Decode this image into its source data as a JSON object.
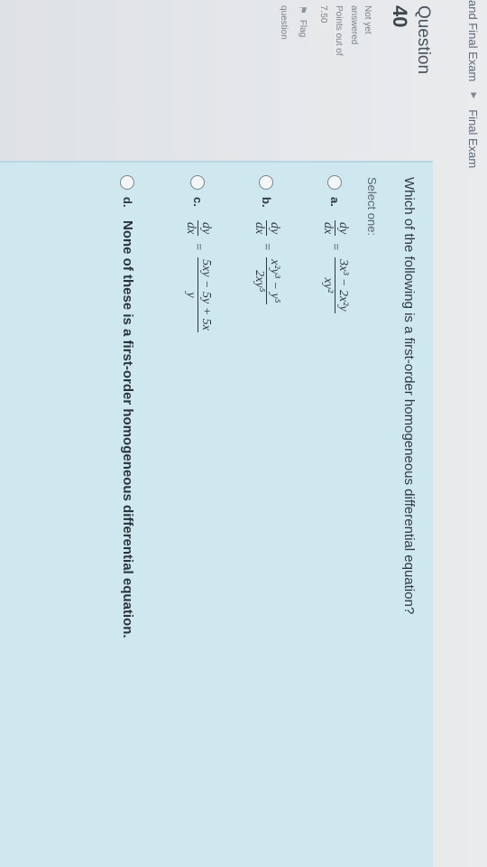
{
  "breadcrumb": {
    "left": "and Final Exam",
    "right": "Final Exam"
  },
  "info": {
    "question_label": "Question",
    "question_number": "40",
    "status_line1": "Not yet",
    "status_line2": "answered",
    "points_label": "Points out of",
    "points_value": "7.50",
    "flag_label": "Flag",
    "flag_label2": "question"
  },
  "question": {
    "text": "Which of the following is a first-order homogeneous differential equation?",
    "select_label": "Select one:",
    "options": [
      {
        "letter": "a.",
        "lhs_top": "dy",
        "lhs_bot": "dx",
        "eq": "=",
        "rhs_top": "3x³ − 2x²y",
        "rhs_bot": "xy²"
      },
      {
        "letter": "b.",
        "lhs_top": "dy",
        "lhs_bot": "dx",
        "eq": "=",
        "rhs_top": "x²y³ − y⁵",
        "rhs_bot": "2xy⁵"
      },
      {
        "letter": "c.",
        "lhs_top": "dy",
        "lhs_bot": "dx",
        "eq": "=",
        "rhs_top": "5xy − 5y + 5x",
        "rhs_bot": "y"
      },
      {
        "letter": "d.",
        "text": "None of these is a first-order homogeneous differential equation."
      }
    ]
  },
  "colors": {
    "panel": "#cfe7ee",
    "background": "#e9ebed"
  }
}
